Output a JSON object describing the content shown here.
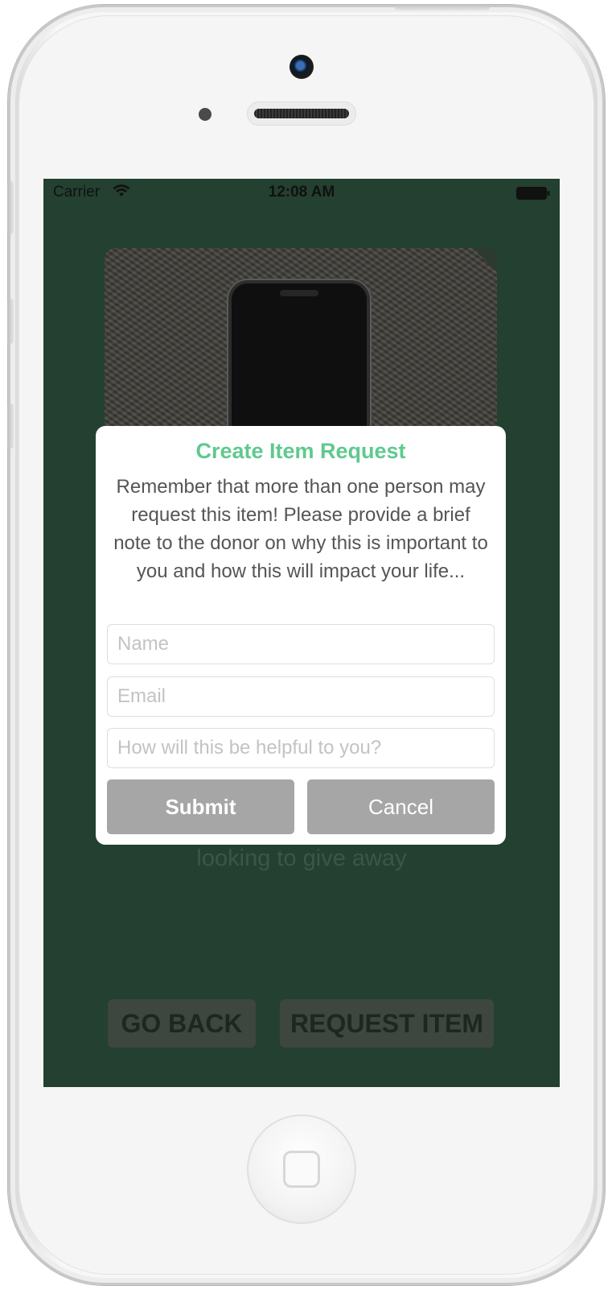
{
  "status_bar": {
    "carrier": "Carrier",
    "time": "12:08 AM"
  },
  "background": {
    "partial_text": "looking to give away",
    "go_back_label": "GO BACK",
    "request_item_label": "REQUEST ITEM"
  },
  "dialog": {
    "title": "Create Item Request",
    "message": "Remember that more than one person may request this item! Please provide a brief note to the donor on why this is important to you and how this will impact your life...",
    "fields": {
      "name_placeholder": "Name",
      "email_placeholder": "Email",
      "help_placeholder": "How will this be helpful to you?"
    },
    "submit_label": "Submit",
    "cancel_label": "Cancel"
  },
  "colors": {
    "screen_background": "#234030",
    "title_accent": "#5fc98e",
    "button_gray": "#a6a6a6"
  }
}
